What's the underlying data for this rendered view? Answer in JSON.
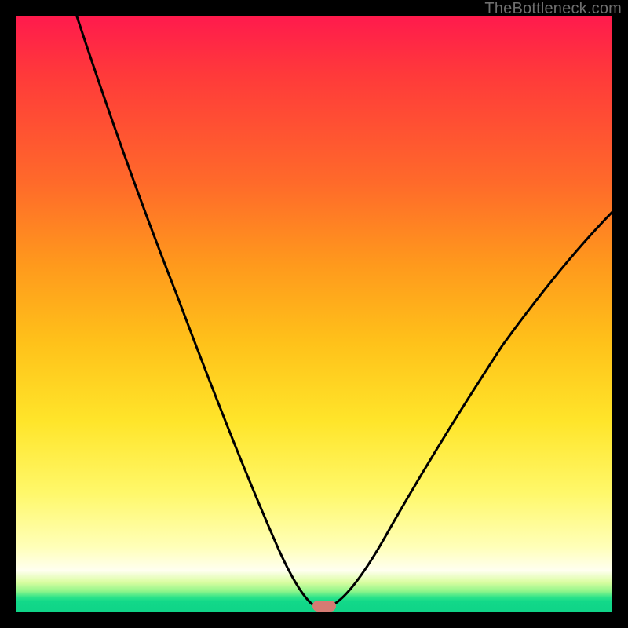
{
  "watermark": "TheBottleneck.com",
  "colors": {
    "frame_background": "#000000",
    "curve_stroke": "#000000",
    "marker_fill": "#d57b73",
    "gradient_stops": [
      "#ff1a4d",
      "#ff3a3a",
      "#ff6a2a",
      "#ff9a1c",
      "#ffc21a",
      "#ffe52a",
      "#fff86a",
      "#ffffb8",
      "#fffff0",
      "#d9fda0",
      "#8ef58b",
      "#2de38a",
      "#12d889",
      "#0fd488"
    ],
    "watermark_text": "#6f6f6f"
  },
  "chart_data": {
    "type": "line",
    "title": "",
    "xlabel": "",
    "ylabel": "",
    "x_range": [
      0,
      100
    ],
    "y_range": [
      0,
      100
    ],
    "description": "V-shaped bottleneck curve; minimum at the marker near x≈52 where the curve touches the bottom (y≈0). Left arm rises to y=100 at x≈10; right arm rises to y≈62 at x=100. Background hue encodes distance from optimum: green at bottom (good), through yellow/orange, to red at top (bad).",
    "series": [
      {
        "name": "bottleneck-curve",
        "x": [
          10,
          14,
          18,
          22,
          26,
          30,
          34,
          38,
          42,
          46,
          49,
          51,
          53,
          55,
          58,
          62,
          66,
          70,
          75,
          80,
          85,
          90,
          95,
          100
        ],
        "y": [
          100,
          90,
          80,
          70,
          60,
          50,
          41,
          32,
          23,
          13,
          5,
          1,
          0,
          1,
          4,
          10,
          17,
          24,
          32,
          40,
          47,
          53,
          58,
          62
        ]
      }
    ],
    "marker": {
      "x": 52,
      "y": 0,
      "shape": "rounded-rect"
    }
  }
}
